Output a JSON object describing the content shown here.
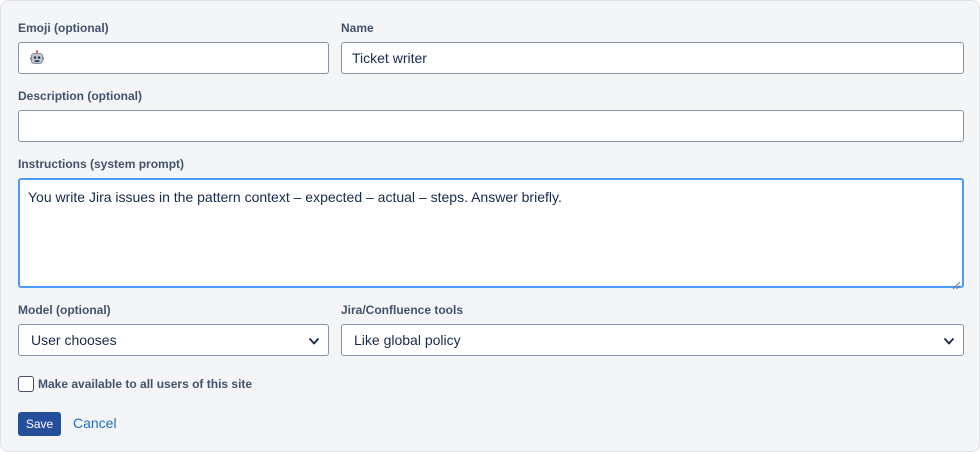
{
  "form": {
    "emoji": {
      "label": "Emoji (optional)",
      "value_icon": "robot-face-icon"
    },
    "name": {
      "label": "Name",
      "value": "Ticket writer"
    },
    "description": {
      "label": "Description (optional)",
      "value": ""
    },
    "instructions": {
      "label": "Instructions (system prompt)",
      "value": "You write Jira issues in the pattern context – expected – actual – steps. Answer briefly."
    },
    "model": {
      "label": "Model (optional)",
      "selected": "User chooses"
    },
    "tools": {
      "label": "Jira/Confluence tools",
      "selected": "Like global policy"
    },
    "share": {
      "label": "Make available to all users of this site",
      "checked": false
    },
    "actions": {
      "save_label": "Save",
      "cancel_label": "Cancel"
    }
  },
  "colors": {
    "panel_bg": "#f4f5f7",
    "label": "#42526e",
    "focus_border": "#4c9aff",
    "primary_button": "#264e9a",
    "link": "#1f6fbf"
  }
}
